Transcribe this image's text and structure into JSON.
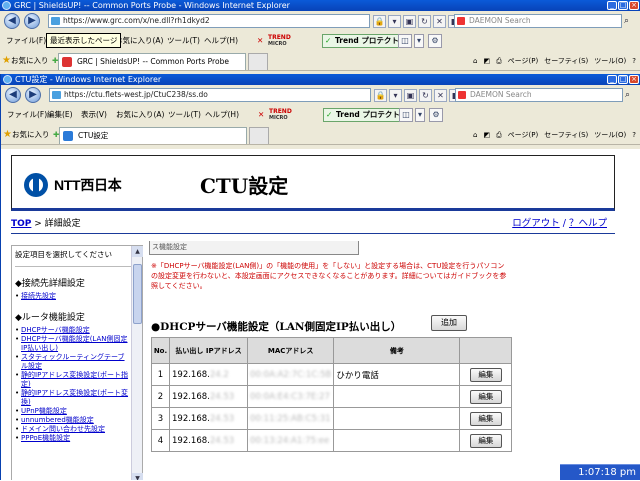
{
  "window1": {
    "title": "GRC | ShieldsUP! -- Common Ports Probe - Windows Internet Explorer",
    "url": "https://www.grc.com/x/ne.dll?rh1dkyd2",
    "search_placeholder": "DAEMON Search",
    "menu": [
      "ファイル(F)",
      "編集(E)",
      "表示(V)",
      "お気に入り(A)",
      "ツール(T)",
      "ヘルプ(H)"
    ],
    "tooltip": "最近表示したページ",
    "trend_brand": "TREND",
    "trend_sub": "MICRO",
    "trend_button": "Trend プロテクト™",
    "favorites_label": "お気に入り",
    "tab_label": "GRC | ShieldsUP! -- Common Ports Probe",
    "tools": [
      "ページ(P)",
      "セーフティ(S)",
      "ツール(O)"
    ]
  },
  "window2": {
    "title": "CTU設定 - Windows Internet Explorer",
    "url": "https://ctu.flets-west.jp/CtuC238/ss.do",
    "search_placeholder": "DAEMON Search",
    "menu": [
      "ファイル(F)",
      "編集(E)",
      "表示(V)",
      "お気に入り(A)",
      "ツール(T)",
      "ヘルプ(H)"
    ],
    "trend_brand": "TREND",
    "trend_sub": "MICRO",
    "trend_button": "Trend プロテクト™",
    "favorites_label": "お気に入り",
    "tab_label": "CTU設定",
    "tools": [
      "ページ(P)",
      "セーフティ(S)",
      "ツール(O)"
    ]
  },
  "site": {
    "brand": "NTT西日本",
    "title": "CTU設定",
    "breadcrumb_top": "TOP",
    "breadcrumb_sep": " > ",
    "breadcrumb_current": "詳細設定",
    "logout": "ログアウト",
    "help": "？ヘルプ"
  },
  "nav": {
    "intro": "設定項目を選択してください",
    "section1": "◆接続先詳細設定",
    "section1_items": [
      "接続先設定"
    ],
    "section2": "◆ルータ機能設定",
    "section2_items": [
      "DHCPサーバ機能設定",
      "DHCPサーバ機能設定(LAN側固定IP払い出し)",
      "スタティックルーティングテーブル設定",
      "静的IPアドレス変換設定(ポート指定)",
      "静的IPアドレス変換設定(ポート変換)",
      "UPnP機能設定",
      "unnumbered機能設定",
      "ドメイン問い合わせ先設定",
      "PPPoE機能設定"
    ]
  },
  "main": {
    "top_box": "ス機能設定",
    "warning": "※「DHCPサーバ機能設定(LAN側)」の「機能の使用」を「しない」と設定する場合は、CTU設定を行うパソコンの設定変更を行わないと、本設定画面にアクセスできなくなることがあります。詳細についてはガイドブックを参照してください。",
    "dhcp_title": "●DHCPサーバ機能設定（LAN側固定IP払い出し）",
    "add_button": "追加",
    "columns": [
      "No.",
      "払い出し IPアドレス",
      "MACアドレス",
      "備考",
      ""
    ],
    "rows": [
      {
        "no": "1",
        "ip": "192.168.",
        "ip_hidden": "24.2",
        "mac_hidden": "00:0A:A2:7C:1C:5B",
        "note": "ひかり電話",
        "action": "編集"
      },
      {
        "no": "2",
        "ip": "192.168.",
        "ip_hidden": "24.53",
        "mac_hidden": "00:0A:E4:C3:7E:27",
        "note": "",
        "action": "編集"
      },
      {
        "no": "3",
        "ip": "192.168.",
        "ip_hidden": "24.53",
        "mac_hidden": "00:11:25:AB:C5:31",
        "note": "",
        "action": "編集"
      },
      {
        "no": "4",
        "ip": "192.168.",
        "ip_hidden": "24.53",
        "mac_hidden": "00:13:24:A1:75:ee",
        "note": "",
        "action": "編集"
      }
    ]
  },
  "taskbar": {
    "clock": "1:07:18 pm"
  }
}
